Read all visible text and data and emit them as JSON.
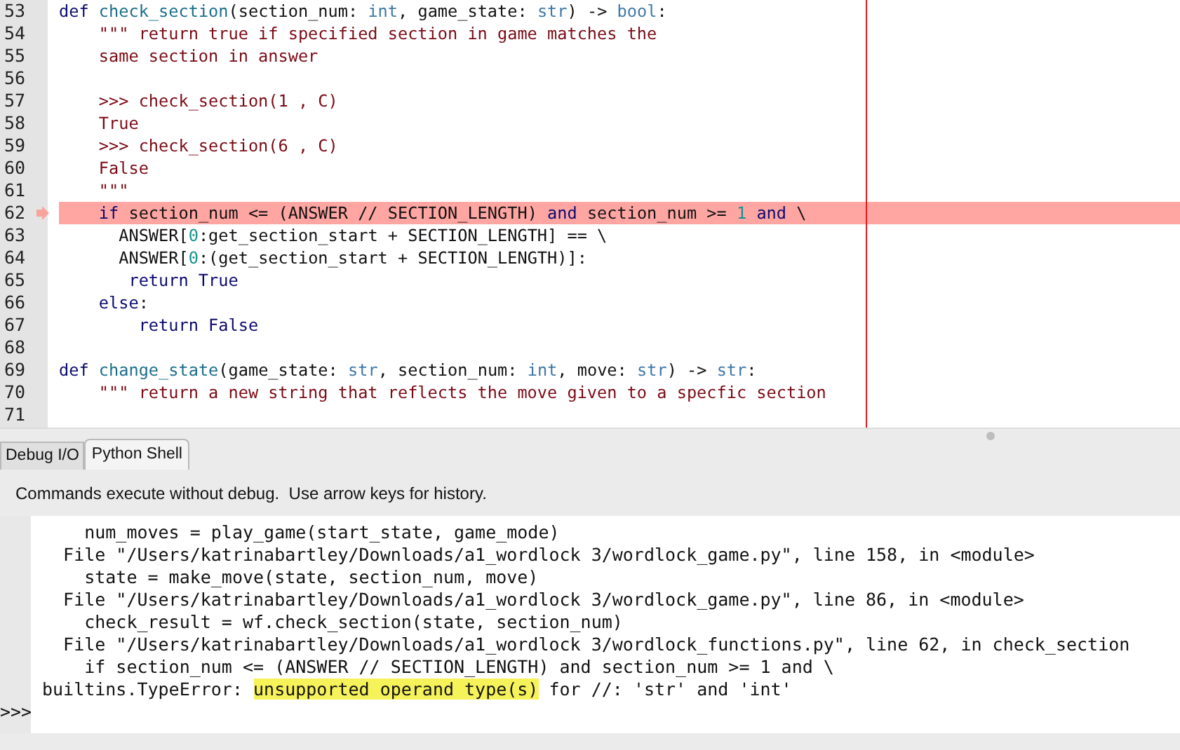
{
  "editor": {
    "lines": [
      {
        "number": "53",
        "current": false,
        "tokens": [
          {
            "kind": "keyword",
            "text": "def "
          },
          {
            "kind": "function",
            "text": "check_section"
          },
          {
            "kind": "plain",
            "text": "(section_num: "
          },
          {
            "kind": "type",
            "text": "int"
          },
          {
            "kind": "plain",
            "text": ", game_state: "
          },
          {
            "kind": "type",
            "text": "str"
          },
          {
            "kind": "plain",
            "text": ") -> "
          },
          {
            "kind": "type",
            "text": "bool"
          },
          {
            "kind": "plain",
            "text": ":"
          }
        ]
      },
      {
        "number": "54",
        "current": false,
        "tokens": [
          {
            "kind": "string",
            "text": "    \"\"\" return true if specified section in game matches the"
          }
        ]
      },
      {
        "number": "55",
        "current": false,
        "tokens": [
          {
            "kind": "string",
            "text": "    same section in answer"
          }
        ]
      },
      {
        "number": "56",
        "current": false
      },
      {
        "number": "57",
        "current": false,
        "tokens": [
          {
            "kind": "string",
            "text": "    >>> check_section(1 , C)"
          }
        ]
      },
      {
        "number": "58",
        "current": false,
        "tokens": [
          {
            "kind": "string",
            "text": "    True"
          }
        ]
      },
      {
        "number": "59",
        "current": false,
        "tokens": [
          {
            "kind": "string",
            "text": "    >>> check_section(6 , C)"
          }
        ]
      },
      {
        "number": "60",
        "current": false,
        "tokens": [
          {
            "kind": "string",
            "text": "    False"
          }
        ]
      },
      {
        "number": "61",
        "current": false,
        "tokens": [
          {
            "kind": "string",
            "text": "    \"\"\""
          }
        ]
      },
      {
        "number": "62",
        "current": true,
        "tokens": [
          {
            "kind": "keyword",
            "text": "    if"
          },
          {
            "kind": "plain",
            "text": " section_num <= (ANSWER // SECTION_LENGTH) "
          },
          {
            "kind": "keyword",
            "text": "and"
          },
          {
            "kind": "plain",
            "text": " section_num >= "
          },
          {
            "kind": "number",
            "text": "1"
          },
          {
            "kind": "keyword",
            "text": " and"
          },
          {
            "kind": "plain",
            "text": " \\"
          }
        ]
      },
      {
        "number": "63",
        "current": false,
        "tokens": [
          {
            "kind": "plain",
            "text": "      ANSWER["
          },
          {
            "kind": "number",
            "text": "0"
          },
          {
            "kind": "plain",
            "text": ":get_section_start + SECTION_LENGTH] == \\"
          }
        ]
      },
      {
        "number": "64",
        "current": false,
        "tokens": [
          {
            "kind": "plain",
            "text": "      ANSWER["
          },
          {
            "kind": "number",
            "text": "0"
          },
          {
            "kind": "plain",
            "text": ":(get_section_start + SECTION_LENGTH)]:"
          }
        ]
      },
      {
        "number": "65",
        "current": false,
        "tokens": [
          {
            "kind": "keyword",
            "text": "       return True"
          }
        ]
      },
      {
        "number": "66",
        "current": false,
        "tokens": [
          {
            "kind": "keyword",
            "text": "    else"
          },
          {
            "kind": "plain",
            "text": ":"
          }
        ]
      },
      {
        "number": "67",
        "current": false,
        "tokens": [
          {
            "kind": "keyword",
            "text": "        return False"
          }
        ]
      },
      {
        "number": "68",
        "current": false
      },
      {
        "number": "69",
        "current": false,
        "tokens": [
          {
            "kind": "keyword",
            "text": "def "
          },
          {
            "kind": "function",
            "text": "change_state"
          },
          {
            "kind": "plain",
            "text": "(game_state: "
          },
          {
            "kind": "type",
            "text": "str"
          },
          {
            "kind": "plain",
            "text": ", section_num: "
          },
          {
            "kind": "type",
            "text": "int"
          },
          {
            "kind": "plain",
            "text": ", move: "
          },
          {
            "kind": "type",
            "text": "str"
          },
          {
            "kind": "plain",
            "text": ") -> "
          },
          {
            "kind": "type",
            "text": "str"
          },
          {
            "kind": "plain",
            "text": ":"
          }
        ]
      },
      {
        "number": "70",
        "current": false,
        "tokens": [
          {
            "kind": "string",
            "text": "    \"\"\" return a new string that reflects the move given to a specfic section"
          }
        ]
      },
      {
        "number": "71",
        "current": false
      }
    ]
  },
  "tabs": [
    {
      "label": "Debug I/O",
      "selected": false
    },
    {
      "label": "Python Shell",
      "selected": true
    }
  ],
  "shell": {
    "info": "Commands execute without debug.  Use arrow keys for history.",
    "lines": [
      [
        {
          "kind": "plain",
          "text": "    num_moves = play_game(start_state, game_mode)"
        }
      ],
      [
        {
          "kind": "plain",
          "text": "  File \"/Users/katrinabartley/Downloads/a1_wordlock 3/wordlock_game.py\", line 158, in <module>"
        }
      ],
      [
        {
          "kind": "plain",
          "text": "    state = make_move(state, section_num, move)"
        }
      ],
      [
        {
          "kind": "plain",
          "text": "  File \"/Users/katrinabartley/Downloads/a1_wordlock 3/wordlock_game.py\", line 86, in <module>"
        }
      ],
      [
        {
          "kind": "plain",
          "text": "    check_result = wf.check_section(state, section_num)"
        }
      ],
      [
        {
          "kind": "plain",
          "text": "  File \"/Users/katrinabartley/Downloads/a1_wordlock 3/wordlock_functions.py\", line 62, in check_section"
        }
      ],
      [
        {
          "kind": "plain",
          "text": "    if section_num <= (ANSWER // SECTION_LENGTH) and section_num >= 1 and \\"
        }
      ],
      [
        {
          "kind": "plain",
          "text": "builtins.TypeError: "
        },
        {
          "kind": "highlight",
          "text": "unsupported operand type(s)"
        },
        {
          "kind": "plain",
          "text": " for //: 'str' and 'int'"
        }
      ]
    ],
    "prompt": ">>>"
  }
}
